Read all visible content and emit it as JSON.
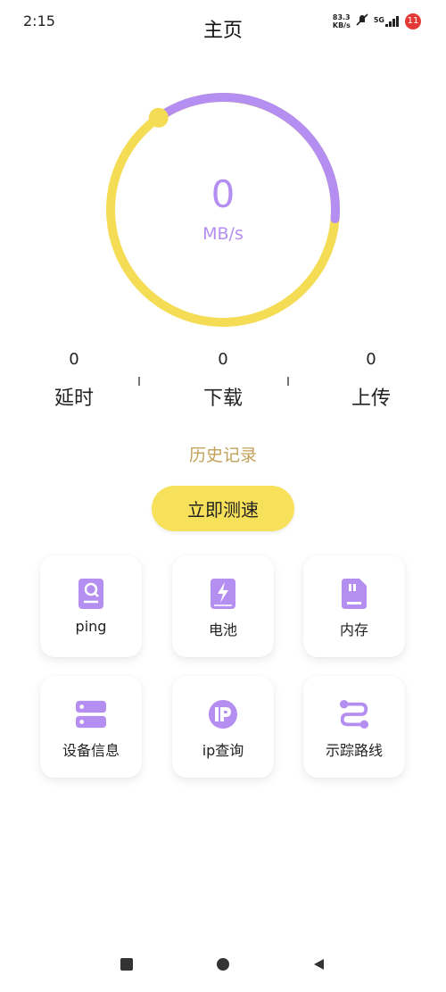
{
  "status_bar": {
    "time": "2:15",
    "net_speed_value": "83.3",
    "net_speed_unit": "KB/s",
    "network": "5G",
    "notification_count": "11"
  },
  "header": {
    "title": "主页"
  },
  "gauge": {
    "value": "0",
    "unit": "MB/s",
    "progress_fraction": 0.36,
    "colors": {
      "track": "#f5dc55",
      "progress": "#b48ef0",
      "knob": "#f5dc55"
    }
  },
  "stats": [
    {
      "value": "0",
      "label": "延时"
    },
    {
      "value": "0",
      "label": "下载"
    },
    {
      "value": "0",
      "label": "上传"
    }
  ],
  "history_label": "历史记录",
  "test_button_label": "立即测速",
  "tools": [
    {
      "icon": "ping-search-icon",
      "label": "ping"
    },
    {
      "icon": "battery-icon",
      "label": "电池"
    },
    {
      "icon": "sd-card-icon",
      "label": "内存"
    },
    {
      "icon": "server-icon",
      "label": "设备信息"
    },
    {
      "icon": "ip-icon",
      "label": "ip查询"
    },
    {
      "icon": "route-icon",
      "label": "示踪路线"
    }
  ],
  "accent_color": "#b48ef0",
  "button_color": "#f7e05a"
}
